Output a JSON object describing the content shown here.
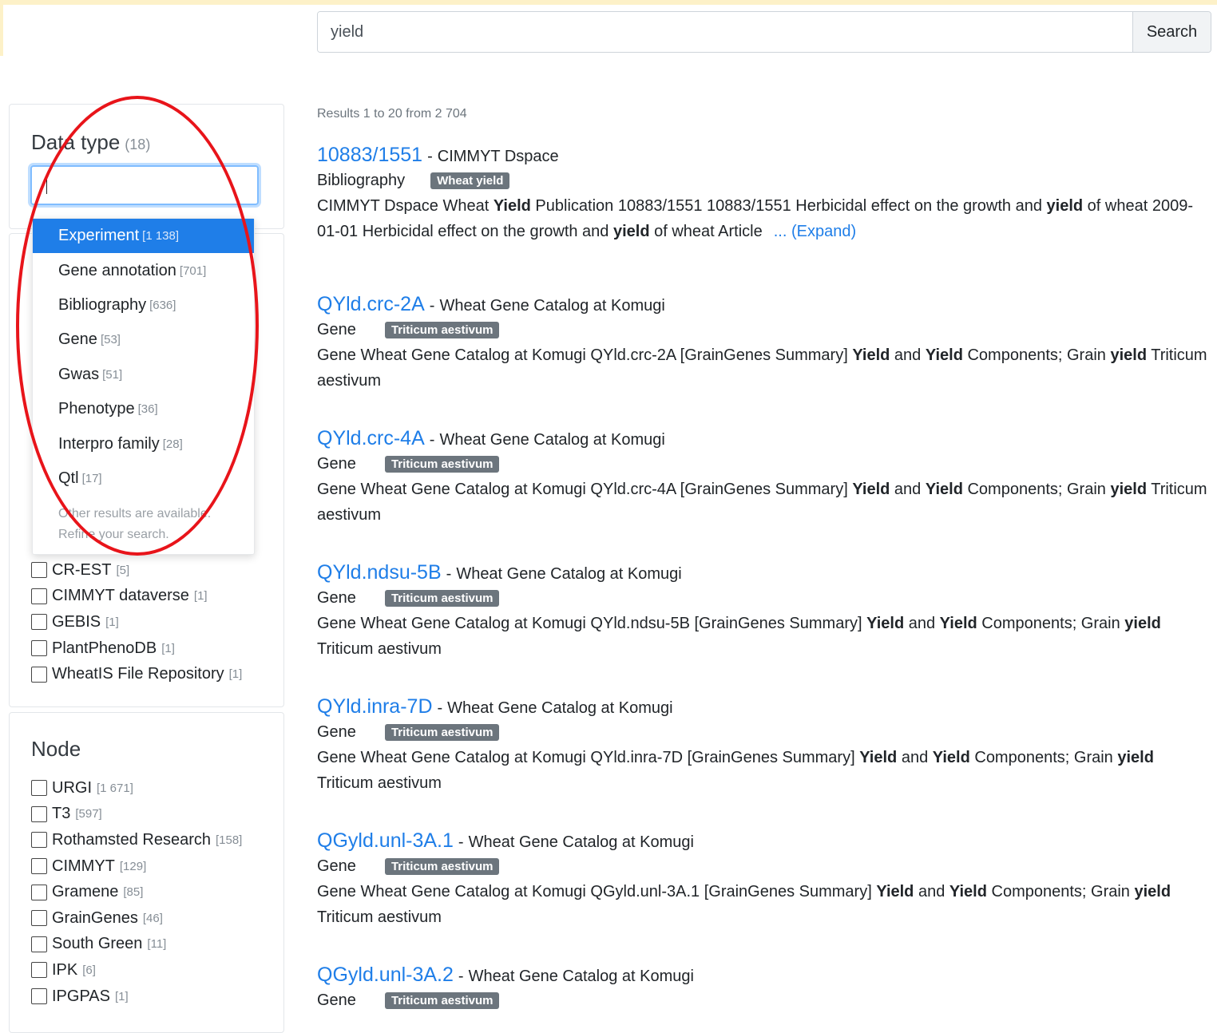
{
  "search": {
    "value": "yield",
    "button_label": "Search"
  },
  "results_info": "Results 1 to 20 from 2 704",
  "data_type_filter": {
    "title": "Data type",
    "count": "(18)",
    "dropdown_items": [
      {
        "label": "Experiment",
        "count": "[1 138]"
      },
      {
        "label": "Gene annotation",
        "count": "[701]"
      },
      {
        "label": "Bibliography",
        "count": "[636]"
      },
      {
        "label": "Gene",
        "count": "[53]"
      },
      {
        "label": "Gwas",
        "count": "[51]"
      },
      {
        "label": "Phenotype",
        "count": "[36]"
      },
      {
        "label": "Interpro family",
        "count": "[28]"
      },
      {
        "label": "Qtl",
        "count": "[17]"
      }
    ],
    "dropdown_note_line1": "Other results are available.",
    "dropdown_note_line2": "Refine your search."
  },
  "source_filter": {
    "items": [
      {
        "label": "CR-EST",
        "count": "[5]"
      },
      {
        "label": "CIMMYT dataverse",
        "count": "[1]"
      },
      {
        "label": "GEBIS",
        "count": "[1]"
      },
      {
        "label": "PlantPhenoDB",
        "count": "[1]"
      },
      {
        "label": "WheatIS File Repository",
        "count": "[1]"
      }
    ]
  },
  "node_filter": {
    "title": "Node",
    "items": [
      {
        "label": "URGI",
        "count": "[1 671]"
      },
      {
        "label": "T3",
        "count": "[597]"
      },
      {
        "label": "Rothamsted Research",
        "count": "[158]"
      },
      {
        "label": "CIMMYT",
        "count": "[129]"
      },
      {
        "label": "Gramene",
        "count": "[85]"
      },
      {
        "label": "GrainGenes",
        "count": "[46]"
      },
      {
        "label": "South Green",
        "count": "[11]"
      },
      {
        "label": "IPK",
        "count": "[6]"
      },
      {
        "label": "IPGPAS",
        "count": "[1]"
      }
    ]
  },
  "results": [
    {
      "title": "10883/1551",
      "sep": "-",
      "source": "CIMMYT Dspace",
      "type": "Bibliography",
      "badge": "Wheat yield",
      "desc": [
        {
          "t": "CIMMYT Dspace Wheat "
        },
        {
          "b": "Yield"
        },
        {
          "t": " Publication 10883/1551 10883/1551 Herbicidal effect on the growth and "
        },
        {
          "b": "yield"
        },
        {
          "t": " of wheat 2009-01-01 Herbicidal effect on the growth and "
        },
        {
          "b": "yield"
        },
        {
          "t": " of wheat Article"
        }
      ],
      "expand": "... (Expand)"
    },
    {
      "title": "QYld.crc-2A",
      "sep": "-",
      "source": "Wheat Gene Catalog at Komugi",
      "type": "Gene",
      "badge": "Triticum aestivum",
      "desc": [
        {
          "t": "Gene Wheat Gene Catalog at Komugi QYld.crc-2A [GrainGenes Summary] "
        },
        {
          "b": "Yield"
        },
        {
          "t": " and "
        },
        {
          "b": "Yield"
        },
        {
          "t": " Components; Grain "
        },
        {
          "b": "yield"
        },
        {
          "t": " Triticum aestivum"
        }
      ]
    },
    {
      "title": "QYld.crc-4A",
      "sep": "-",
      "source": "Wheat Gene Catalog at Komugi",
      "type": "Gene",
      "badge": "Triticum aestivum",
      "desc": [
        {
          "t": "Gene Wheat Gene Catalog at Komugi QYld.crc-4A [GrainGenes Summary] "
        },
        {
          "b": "Yield"
        },
        {
          "t": " and "
        },
        {
          "b": "Yield"
        },
        {
          "t": " Components; Grain "
        },
        {
          "b": "yield"
        },
        {
          "t": " Triticum aestivum"
        }
      ]
    },
    {
      "title": "QYld.ndsu-5B",
      "sep": "-",
      "source": "Wheat Gene Catalog at Komugi",
      "type": "Gene",
      "badge": "Triticum aestivum",
      "desc": [
        {
          "t": "Gene Wheat Gene Catalog at Komugi QYld.ndsu-5B [GrainGenes Summary] "
        },
        {
          "b": "Yield"
        },
        {
          "t": " and "
        },
        {
          "b": "Yield"
        },
        {
          "t": " Components; Grain "
        },
        {
          "b": "yield"
        },
        {
          "t": " Triticum aestivum"
        }
      ]
    },
    {
      "title": "QYld.inra-7D",
      "sep": "-",
      "source": "Wheat Gene Catalog at Komugi",
      "type": "Gene",
      "badge": "Triticum aestivum",
      "desc": [
        {
          "t": "Gene Wheat Gene Catalog at Komugi QYld.inra-7D [GrainGenes Summary] "
        },
        {
          "b": "Yield"
        },
        {
          "t": " and "
        },
        {
          "b": "Yield"
        },
        {
          "t": " Components; Grain "
        },
        {
          "b": "yield"
        },
        {
          "t": " Triticum aestivum"
        }
      ]
    },
    {
      "title": "QGyld.unl-3A.1",
      "sep": "-",
      "source": "Wheat Gene Catalog at Komugi",
      "type": "Gene",
      "badge": "Triticum aestivum",
      "desc": [
        {
          "t": "Gene Wheat Gene Catalog at Komugi QGyld.unl-3A.1 [GrainGenes Summary] "
        },
        {
          "b": "Yield"
        },
        {
          "t": " and "
        },
        {
          "b": "Yield"
        },
        {
          "t": " Components; Grain "
        },
        {
          "b": "yield"
        },
        {
          "t": " Triticum aestivum"
        }
      ]
    },
    {
      "title": "QGyld.unl-3A.2",
      "sep": "-",
      "source": "Wheat Gene Catalog at Komugi",
      "type": "Gene",
      "badge": "Triticum aestivum",
      "desc": []
    }
  ]
}
